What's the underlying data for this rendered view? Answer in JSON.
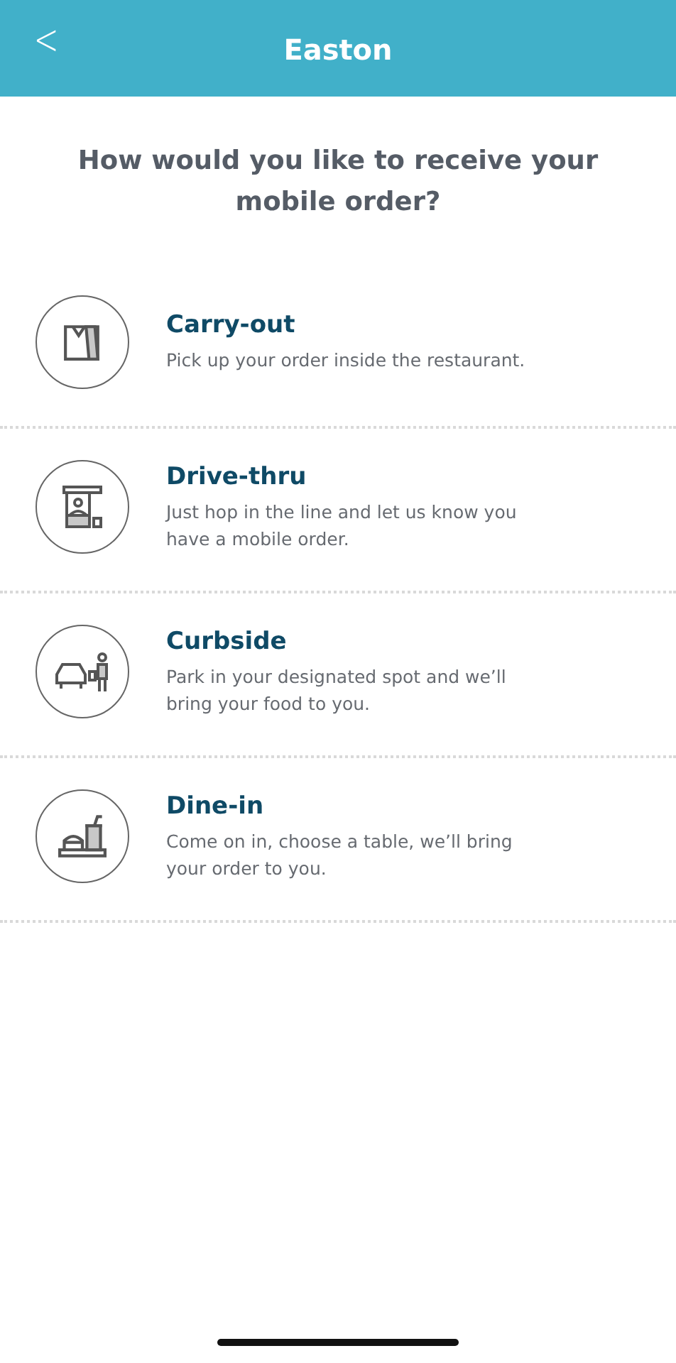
{
  "header": {
    "back": "<",
    "title": "Easton"
  },
  "question": "How would you like to receive your mobile order?",
  "options": [
    {
      "kind": "bag",
      "title": "Carry-out",
      "description": "Pick up your order inside the restaurant."
    },
    {
      "kind": "window",
      "title": "Drive-thru",
      "description": "Just hop in the line and let us know you have a mobile order."
    },
    {
      "kind": "car",
      "title": "Curbside",
      "description": "Park in your designated spot and we’ll bring your food to you."
    },
    {
      "kind": "tray",
      "title": "Dine-in",
      "description": "Come on in, choose a table, we’ll bring your order to you."
    }
  ]
}
